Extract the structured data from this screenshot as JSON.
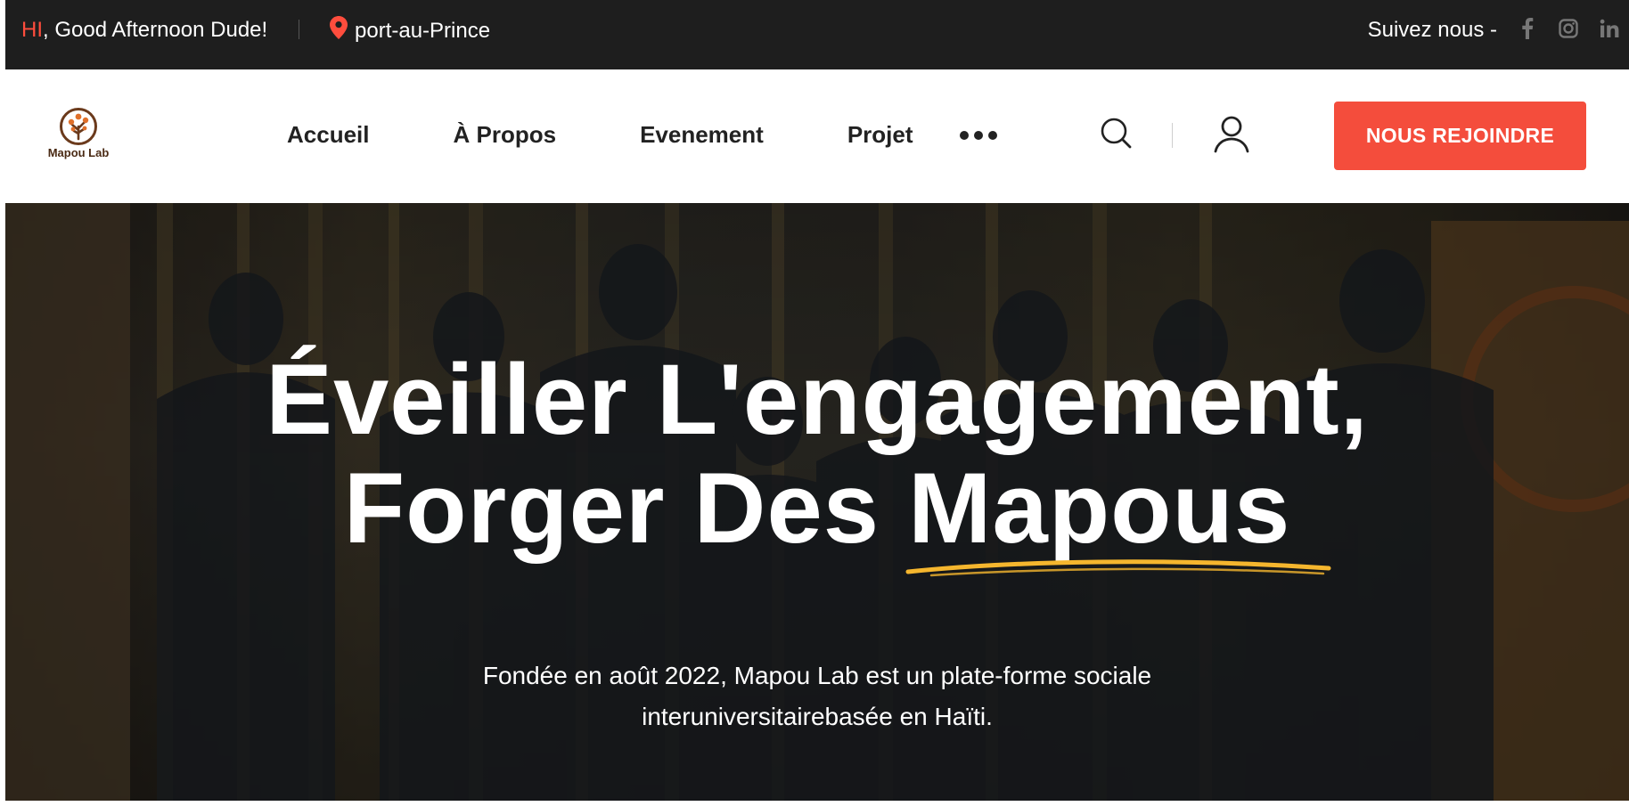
{
  "topbar": {
    "greeting_hi": "HI",
    "greeting_rest": ", Good Afternoon Dude!",
    "location": "port-au-Prince",
    "follow_label": "Suivez nous -",
    "social_icons": [
      "facebook-icon",
      "instagram-icon",
      "linkedin-icon"
    ]
  },
  "header": {
    "logo_text": "Mapou Lab",
    "nav": [
      "Accueil",
      "À Propos",
      "Evenement",
      "Projet"
    ],
    "cta_label": "NOUS REJOINDRE"
  },
  "hero": {
    "title_line1": "Éveiller L'engagement,",
    "title_line2_prefix": "Forger Des ",
    "title_line2_highlight": "Mapous",
    "subtitle_line1": "Fondée en août 2022, Mapou Lab est un plate-forme sociale",
    "subtitle_line2": "interuniversitairebasée en Haïti."
  },
  "colors": {
    "accent": "#f44d3c",
    "topbar_bg": "#1e1e1e",
    "underline": "#f5b62e"
  }
}
